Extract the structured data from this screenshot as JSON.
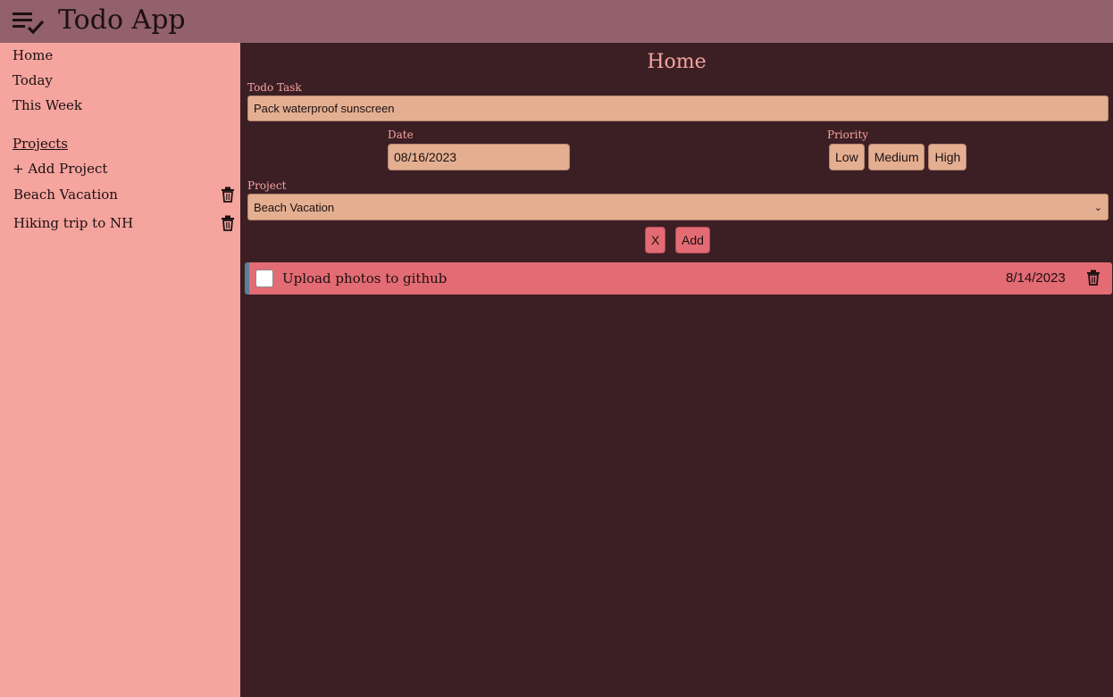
{
  "header": {
    "title": "Todo App",
    "logo_icon": "checklist-icon"
  },
  "sidebar": {
    "nav": [
      {
        "label": "Home"
      },
      {
        "label": "Today"
      },
      {
        "label": "This Week"
      }
    ],
    "projects_heading": "Projects",
    "add_project": "+ Add Project",
    "projects": [
      {
        "label": "Beach Vacation",
        "icon": "trash-icon"
      },
      {
        "label": "Hiking trip to NH",
        "icon": "trash-icon"
      }
    ]
  },
  "main": {
    "title": "Home",
    "form": {
      "task_label": "Todo Task",
      "task_value": "Pack waterproof sunscreen",
      "date_label": "Date",
      "date_value": "08/16/2023",
      "priority_label": "Priority",
      "priority_options": [
        "Low",
        "Medium",
        "High"
      ],
      "project_label": "Project",
      "project_selected": "Beach Vacation",
      "cancel_label": "X",
      "add_label": "Add"
    },
    "todos": [
      {
        "title": "Upload photos to github",
        "date": "8/14/2023",
        "checked": false,
        "priority_color": "#5f7f98"
      }
    ]
  },
  "colors": {
    "header_bg": "#92616c",
    "sidebar_bg": "#f5a49e",
    "main_bg": "#3c1f25",
    "accent": "#e36b73",
    "input_bg": "#e4af91"
  }
}
